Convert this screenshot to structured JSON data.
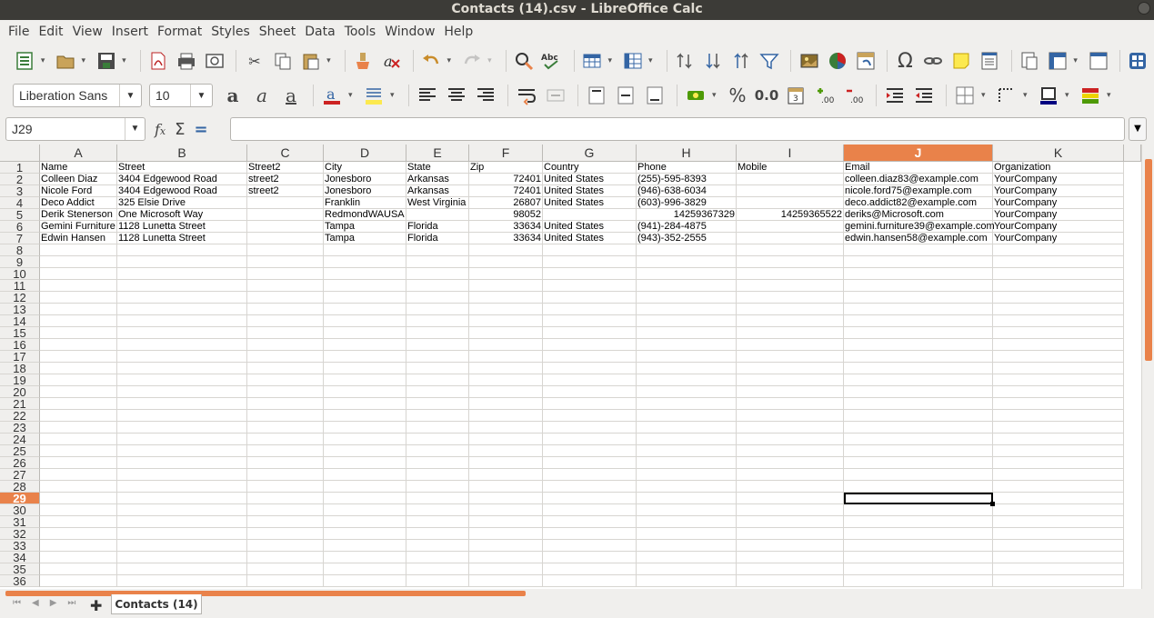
{
  "window": {
    "title": "Contacts (14).csv - LibreOffice Calc"
  },
  "menu": [
    "File",
    "Edit",
    "View",
    "Insert",
    "Format",
    "Styles",
    "Sheet",
    "Data",
    "Tools",
    "Window",
    "Help"
  ],
  "format_toolbar": {
    "font_name": "Liberation Sans",
    "font_size": "10"
  },
  "name_box": {
    "value": "J29"
  },
  "formula": {
    "value": ""
  },
  "selected_cell": {
    "column": "J",
    "row": 29
  },
  "columns": [
    "A",
    "B",
    "C",
    "D",
    "E",
    "F",
    "G",
    "H",
    "I",
    "J",
    "K"
  ],
  "row_count": 36,
  "rows": [
    [
      "Name",
      "Street",
      "Street2",
      "City",
      "State",
      "Zip",
      "Country",
      "Phone",
      "Mobile",
      "Email",
      "Organization"
    ],
    [
      "Colleen Diaz",
      "3404  Edgewood Road",
      "street2",
      "Jonesboro",
      "Arkansas",
      "72401",
      "United States",
      "(255)-595-8393",
      "",
      "colleen.diaz83@example.com",
      "YourCompany"
    ],
    [
      "Nicole Ford",
      "3404  Edgewood Road",
      "street2",
      "Jonesboro",
      "Arkansas",
      "72401",
      "United States",
      "(946)-638-6034",
      "",
      "nicole.ford75@example.com",
      "YourCompany"
    ],
    [
      "Deco Addict",
      "325 Elsie Drive",
      "",
      "Franklin",
      "West Virginia",
      "26807",
      "United States",
      "(603)-996-3829",
      "",
      "deco.addict82@example.com",
      "YourCompany"
    ],
    [
      "Derik Stenerson",
      "One Microsoft Way",
      "",
      "RedmondWAUSA",
      "",
      "98052",
      "",
      "14259367329",
      "14259365522",
      "deriks@Microsoft.com",
      "YourCompany"
    ],
    [
      "Gemini Furniture",
      "1128 Lunetta Street",
      "",
      "Tampa",
      "Florida",
      "33634",
      "United States",
      "(941)-284-4875",
      "",
      "gemini.furniture39@example.com",
      "YourCompany"
    ],
    [
      "Edwin Hansen",
      "1128 Lunetta Street",
      "",
      "Tampa",
      "Florida",
      "33634",
      "United States",
      "(943)-352-2555",
      "",
      "edwin.hansen58@example.com",
      "YourCompany"
    ]
  ],
  "sheet_tab": {
    "label": "Contacts (14)"
  },
  "accent_color": "#e9824a"
}
